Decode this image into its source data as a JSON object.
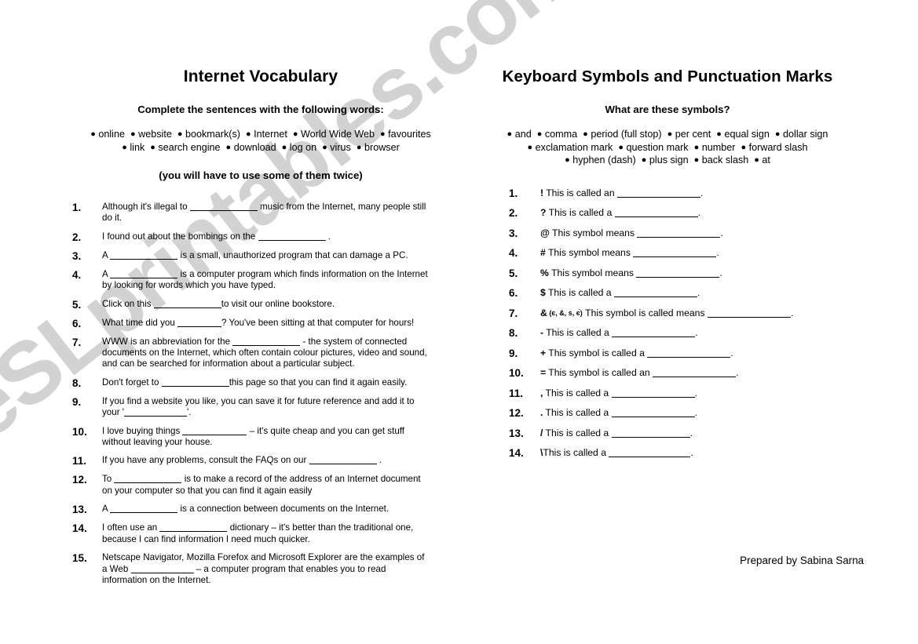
{
  "watermark": {
    "text": "eSLprintables.com",
    "color": "#d2d2d2"
  },
  "left": {
    "title": "Internet Vocabulary",
    "instruction": "Complete the sentences with the following words:",
    "wordbank_line1": [
      "online",
      "website",
      "bookmark(s)",
      "Internet",
      "World Wide Web",
      "favourites"
    ],
    "wordbank_line2": [
      "link",
      "search engine",
      "download",
      "log on",
      "virus",
      "browser"
    ],
    "note": "(you will have to use some of them twice)",
    "items": [
      {
        "num": "1.",
        "before": "Although it's illegal to ",
        "blank": 86,
        "after": " music from the Internet, many people still do it."
      },
      {
        "num": "2.",
        "before": "I found out about the bombings on the ",
        "blank": 86,
        "after": " ."
      },
      {
        "num": "3.",
        "before": "A ",
        "blank": 86,
        "after": " is a small, unauthorized program that can damage a PC."
      },
      {
        "num": "4.",
        "before": "A ",
        "blank": 86,
        "after": "  is a computer program which finds information on the Internet by looking for words which you have typed."
      },
      {
        "num": "5.",
        "before": "Click on this ",
        "blank": 86,
        "after": "to visit our online bookstore."
      },
      {
        "num": "6.",
        "before": "What time did you ",
        "blank": 56,
        "after": "? You've been sitting at that computer for hours!"
      },
      {
        "num": "7.",
        "before": "WWW is an abbreviation for the ",
        "blank": 86,
        "after": " - the system of connected documents on the Internet, which often contain colour pictures, video and sound, and can be searched for information about a particular subject."
      },
      {
        "num": "8.",
        "before": "Don't forget to ",
        "blank": 86,
        "after": "this page so that you can find it again easily."
      },
      {
        "num": "9.",
        "before": "If you find a website you like, you can save it for future reference and add it to your '",
        "blank": 80,
        "after": "'."
      },
      {
        "num": "10.",
        "before": "I love buying things ",
        "blank": 82,
        "after": " – it's quite cheap and you can get stuff without leaving your house."
      },
      {
        "num": "11.",
        "before": "If you have any problems, consult the FAQs on our ",
        "blank": 86,
        "after": " ."
      },
      {
        "num": "12.",
        "before": "To ",
        "blank": 86,
        "after": " is to make a record of the address of an Internet document on your computer so that you can find it again easily"
      },
      {
        "num": "13.",
        "before": "A ",
        "blank": 86,
        "after": " is a connection between documents on the Internet."
      },
      {
        "num": "14.",
        "before": "I often use an ",
        "blank": 86,
        "after": " dictionary – it's better than the traditional one, because I can find information I need much quicker."
      },
      {
        "num": "15.",
        "before": "Netscape Navigator, Mozilla Forefox  and Microsoft Explorer are the examples of a Web ",
        "blank": 80,
        "after": " – a computer program that enables you to read information on the Internet."
      }
    ]
  },
  "right": {
    "title": "Keyboard Symbols and Punctuation Marks",
    "instruction": "What are these symbols?",
    "wordbank_line1": [
      "and",
      "comma",
      "period (full stop)",
      "per cent",
      "equal sign",
      "dollar sign"
    ],
    "wordbank_line2": [
      "exclamation mark",
      "question mark",
      "number",
      "forward slash"
    ],
    "wordbank_line3": [
      "hyphen (dash)",
      "plus sign",
      "back slash",
      "at"
    ],
    "items": [
      {
        "num": "1.",
        "symbol": "!",
        "variants": "",
        "before": " This is called an ",
        "blank": 106,
        "after": "."
      },
      {
        "num": "2.",
        "symbol": "?",
        "variants": "",
        "before": " This is called a ",
        "blank": 106,
        "after": "."
      },
      {
        "num": "3.",
        "symbol": "@",
        "variants": "",
        "before": " This symbol means ",
        "blank": 106,
        "after": "."
      },
      {
        "num": "4.",
        "symbol": "#",
        "variants": "",
        "before": " This symbol means ",
        "blank": 106,
        "after": "."
      },
      {
        "num": "5.",
        "symbol": "%",
        "variants": "",
        "before": " This symbol means ",
        "blank": 106,
        "after": "."
      },
      {
        "num": "6.",
        "symbol": "$",
        "variants": "",
        "before": " This is called a ",
        "blank": 106,
        "after": "."
      },
      {
        "num": "7.",
        "symbol": "&",
        "variants": "(є,  &, ѕ, є́)",
        "before": " This symbol is called means ",
        "blank": 106,
        "after": "."
      },
      {
        "num": "8.",
        "symbol": "-",
        "variants": "",
        "before": " This is called a ",
        "blank": 106,
        "after": "."
      },
      {
        "num": "9.",
        "symbol": "+",
        "variants": "",
        "before": " This symbol is called a ",
        "blank": 106,
        "after": "."
      },
      {
        "num": "10.",
        "symbol": "=",
        "variants": "",
        "before": " This symbol is called an ",
        "blank": 106,
        "after": "."
      },
      {
        "num": "11.",
        "symbol": ",",
        "variants": "",
        "before": " This is called a ",
        "blank": 106,
        "after": "."
      },
      {
        "num": "12.",
        "symbol": ".",
        "variants": "",
        "before": " This is called a ",
        "blank": 106,
        "after": "."
      },
      {
        "num": "13.",
        "symbol": "/",
        "variants": "",
        "before": " This is called a ",
        "blank": 100,
        "after": "."
      },
      {
        "num": "14.",
        "symbol": "\\",
        "variants": "",
        "before": "This is called a ",
        "blank": 104,
        "after": "."
      }
    ]
  },
  "credit": "Prepared by Sabina Sarna"
}
